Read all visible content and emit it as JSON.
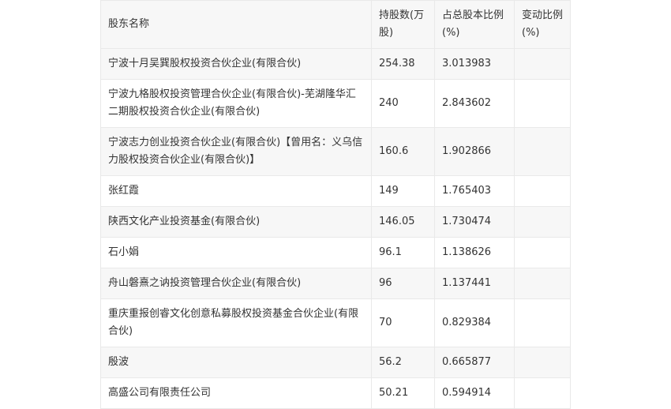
{
  "table": {
    "headers": {
      "name": "股东名称",
      "shares": "持股数(万股)",
      "ratio": "占总股本比例(%)",
      "change": "变动比例(%)"
    },
    "rows": [
      {
        "name": "宁波十月吴巽股权投资合伙企业(有限合伙)",
        "shares": "254.38",
        "ratio": "3.013983",
        "change": ""
      },
      {
        "name": "宁波九格股权投资管理合伙企业(有限合伙)-芜湖隆华汇二期股权投资合伙企业(有限合伙)",
        "shares": "240",
        "ratio": "2.843602",
        "change": ""
      },
      {
        "name": "宁波志力创业投资合伙企业(有限合伙)【曾用名：义乌信力股权投资合伙企业(有限合伙)】",
        "shares": "160.6",
        "ratio": "1.902866",
        "change": ""
      },
      {
        "name": "张红霞",
        "shares": "149",
        "ratio": "1.765403",
        "change": ""
      },
      {
        "name": "陕西文化产业投资基金(有限合伙)",
        "shares": "146.05",
        "ratio": "1.730474",
        "change": ""
      },
      {
        "name": "石小娟",
        "shares": "96.1",
        "ratio": "1.138626",
        "change": ""
      },
      {
        "name": "舟山磐熹之讷投资管理合伙企业(有限合伙)",
        "shares": "96",
        "ratio": "1.137441",
        "change": ""
      },
      {
        "name": "重庆重报创睿文化创意私募股权投资基金合伙企业(有限合伙)",
        "shares": "70",
        "ratio": "0.829384",
        "change": ""
      },
      {
        "name": "殷波",
        "shares": "56.2",
        "ratio": "0.665877",
        "change": ""
      },
      {
        "name": "高盛公司有限责任公司",
        "shares": "50.21",
        "ratio": "0.594914",
        "change": ""
      }
    ]
  }
}
